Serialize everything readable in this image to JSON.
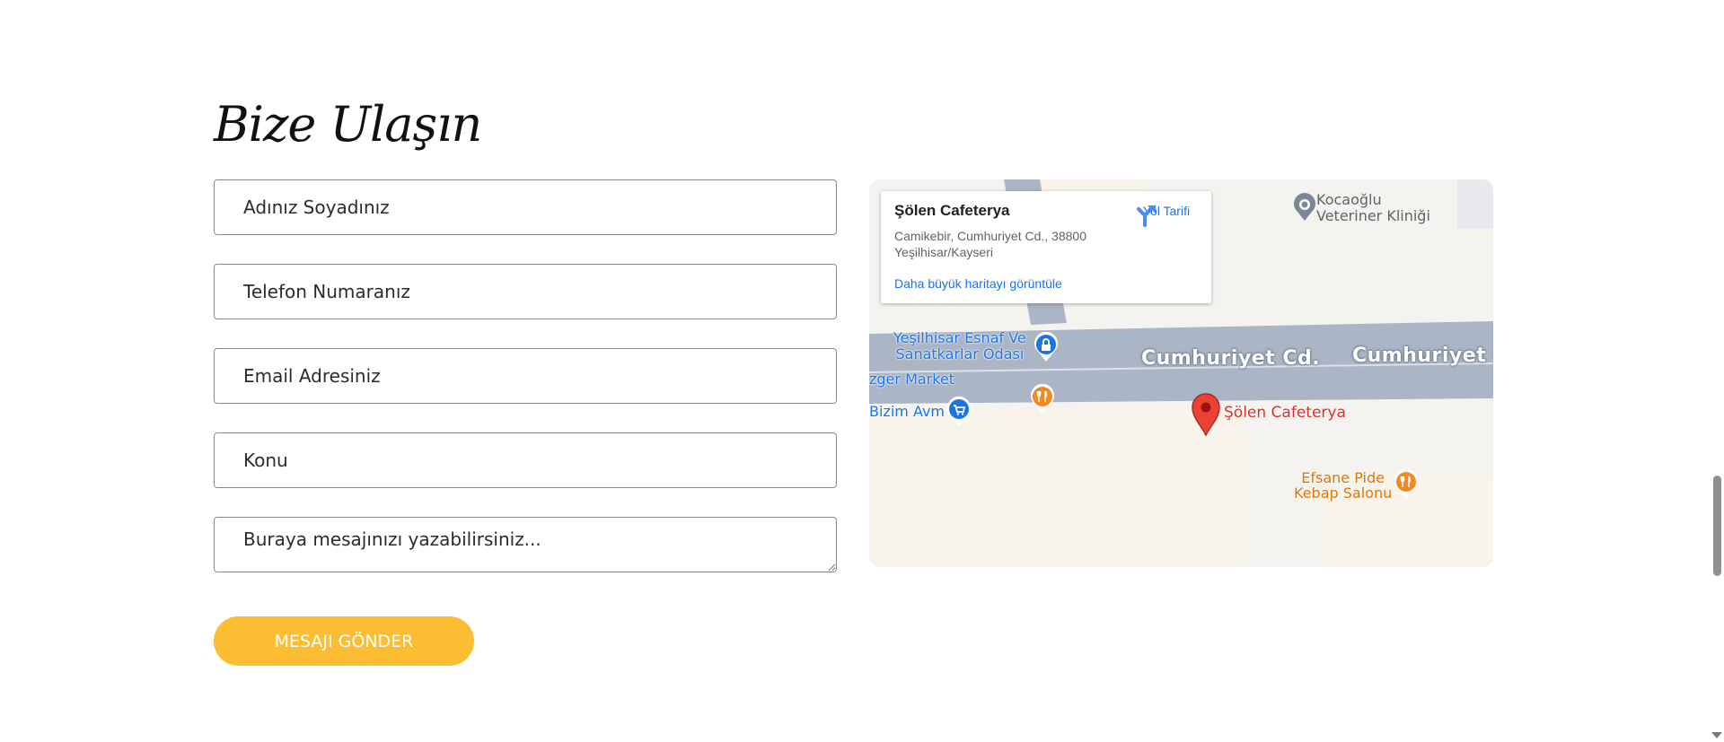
{
  "contact": {
    "title": "Bize Ulaşın",
    "name_placeholder": "Adınız Soyadınız",
    "phone_placeholder": "Telefon Numaranız",
    "email_placeholder": "Email Adresiniz",
    "subject_placeholder": "Konu",
    "message_placeholder": "Buraya mesajınızı yazabilirsiniz...",
    "submit_label": "MESAJI GÖNDER"
  },
  "map": {
    "info_card": {
      "name": "Şölen Cafeterya",
      "address": "Camikebir, Cumhuriyet Cd., 38800 Yeşilhisar/Kayseri",
      "larger_map_link": "Daha büyük haritayı görüntüle",
      "directions_label": "Yol Tarifi"
    },
    "places": {
      "vet_line1": "Kocaoğlu",
      "vet_line2": "Veteriner Kliniği",
      "chamber_line1": "Yeşilhisar Esnaf Ve",
      "chamber_line2": "Sanatkarlar Odası",
      "market": "zger Market",
      "avm": "Bizim Avm",
      "pide_line1": "Efsane Pide",
      "pide_line2": "Kebap Salonu",
      "marker": "Şölen Cafeterya"
    },
    "streets": {
      "street_1": "Cumhuriyet Cd.",
      "street_2": "Cumhuriyet C"
    }
  },
  "colors": {
    "button": "#fdbd33",
    "road": "#aab5c6",
    "marker": "#ea4335",
    "link": "#1a73e8",
    "poi_orange": "#f08a24"
  }
}
